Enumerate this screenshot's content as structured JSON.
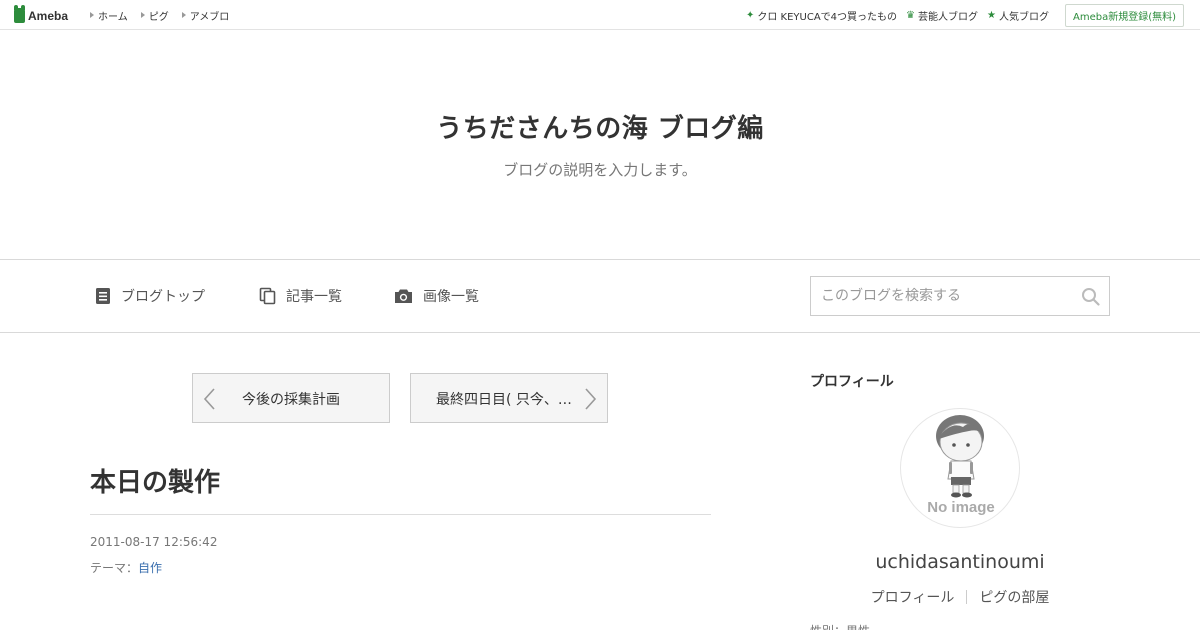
{
  "topbar": {
    "logo": "Ameba",
    "nav": [
      "ホーム",
      "ピグ",
      "アメブロ"
    ],
    "right": {
      "promo": "クロ KEYUCAで4つ買ったもの",
      "celebrity": "芸能人ブログ",
      "popular": "人気ブログ",
      "signup": "Ameba新規登録(無料)"
    }
  },
  "header": {
    "title": "うちださんちの海 ブログ編",
    "description": "ブログの説明を入力します。"
  },
  "nav": {
    "blog_top": "ブログトップ",
    "articles": "記事一覧",
    "images": "画像一覧"
  },
  "search": {
    "placeholder": "このブログを検索する"
  },
  "pager": {
    "prev": "今後の採集計画",
    "next": "最終四日目( 只今、…"
  },
  "entry": {
    "title": "本日の製作",
    "date": "2011-08-17 12:56:42",
    "theme_label": "テーマ：",
    "theme": "自作"
  },
  "sidebar": {
    "heading": "プロフィール",
    "avatar_text": "No image",
    "name": "uchidasantinoumi",
    "links": [
      "プロフィール",
      "ピグの部屋"
    ],
    "cutoff": "性別：男性"
  },
  "colors": {
    "accent": "#2d8c3c",
    "link": "#3b6fae"
  }
}
